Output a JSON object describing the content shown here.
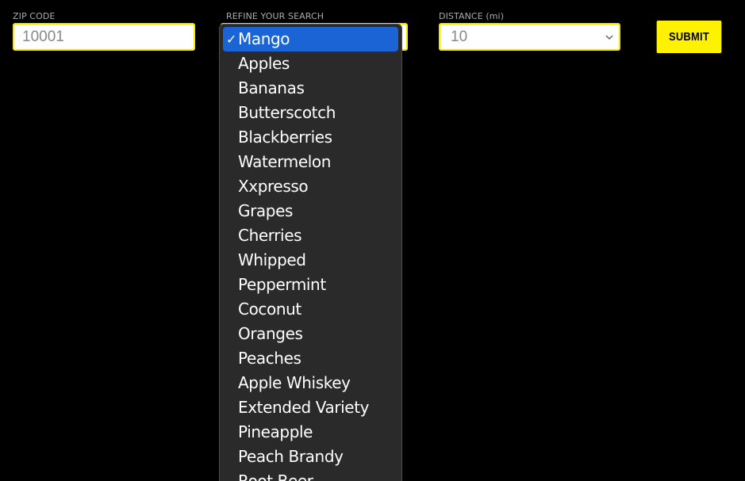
{
  "form": {
    "zip": {
      "label": "ZIP CODE",
      "value": "10001"
    },
    "refine": {
      "label": "REFINE YOUR SEARCH"
    },
    "distance": {
      "label": "DISTANCE (mi)",
      "value": "10"
    },
    "submit_label": "SUBMIT"
  },
  "dropdown": {
    "checkmark": "✓",
    "items": [
      "Mango",
      "Apples",
      "Bananas",
      "Butterscotch",
      "Blackberries",
      "Watermelon",
      "Xxpresso",
      "Grapes",
      "Cherries",
      "Whipped",
      "Peppermint",
      "Coconut",
      "Oranges",
      "Peaches",
      "Apple Whiskey",
      "Extended Variety",
      "Pineapple",
      "Peach Brandy",
      "Root Beer"
    ],
    "selected_index": 0
  },
  "colors": {
    "accent_yellow": "#fff200",
    "selection_blue": "#1a64d6",
    "menu_bg": "#2a2a2a",
    "page_bg": "#000000"
  },
  "icons": {
    "distance_select": "chevron-down-icon",
    "selected_item": "check-icon"
  }
}
